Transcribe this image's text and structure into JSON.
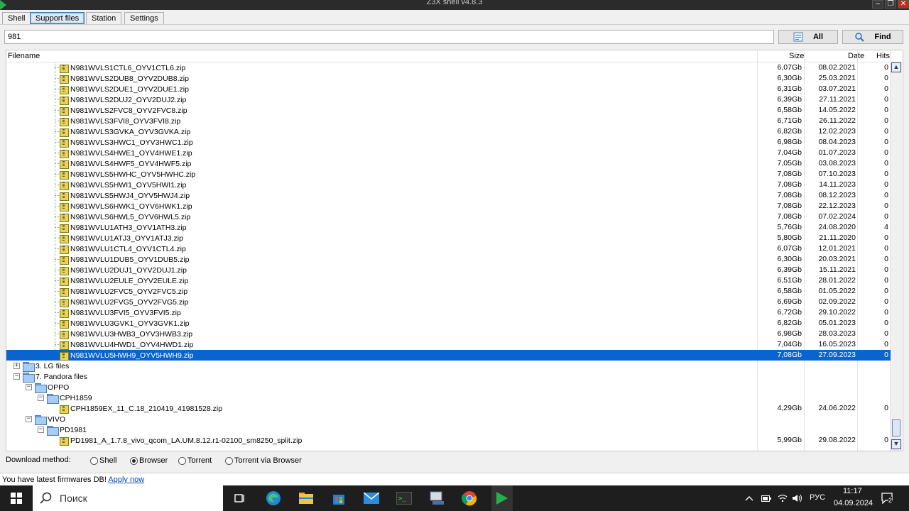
{
  "window": {
    "title": "Z3X shell v4.8.3",
    "controls": [
      "–",
      "❐",
      "✕"
    ]
  },
  "tabs": [
    {
      "label": "Shell",
      "active": false
    },
    {
      "label": "Support files",
      "active": true
    },
    {
      "label": "Station",
      "active": false
    },
    {
      "label": "Settings",
      "active": false
    }
  ],
  "search": {
    "value": "981",
    "all_label": "All",
    "find_label": "Find"
  },
  "columns": {
    "filename": "Filename",
    "size": "Size",
    "date": "Date",
    "hits": "Hits"
  },
  "files": [
    {
      "name": "N981WVLS1CTL6_OYV1CTL6.zip",
      "size": "6,07Gb",
      "date": "08.02.2021",
      "hits": "0"
    },
    {
      "name": "N981WVLS2DUB8_OYV2DUB8.zip",
      "size": "6,30Gb",
      "date": "25.03.2021",
      "hits": "0"
    },
    {
      "name": "N981WVLS2DUE1_OYV2DUE1.zip",
      "size": "6,31Gb",
      "date": "03.07.2021",
      "hits": "0"
    },
    {
      "name": "N981WVLS2DUJ2_OYV2DUJ2.zip",
      "size": "6,39Gb",
      "date": "27.11.2021",
      "hits": "0"
    },
    {
      "name": "N981WVLS2FVC8_OYV2FVC8.zip",
      "size": "6,58Gb",
      "date": "14.05.2022",
      "hits": "0"
    },
    {
      "name": "N981WVLS3FVI8_OYV3FVI8.zip",
      "size": "6,71Gb",
      "date": "26.11.2022",
      "hits": "0"
    },
    {
      "name": "N981WVLS3GVKA_OYV3GVKA.zip",
      "size": "6,82Gb",
      "date": "12.02.2023",
      "hits": "0"
    },
    {
      "name": "N981WVLS3HWC1_OYV3HWC1.zip",
      "size": "6,98Gb",
      "date": "08.04.2023",
      "hits": "0"
    },
    {
      "name": "N981WVLS4HWE1_OYV4HWE1.zip",
      "size": "7,04Gb",
      "date": "01.07.2023",
      "hits": "0"
    },
    {
      "name": "N981WVLS4HWF5_OYV4HWF5.zip",
      "size": "7,05Gb",
      "date": "03.08.2023",
      "hits": "0"
    },
    {
      "name": "N981WVLS5HWHC_OYV5HWHC.zip",
      "size": "7,08Gb",
      "date": "07.10.2023",
      "hits": "0"
    },
    {
      "name": "N981WVLS5HWI1_OYV5HWI1.zip",
      "size": "7,08Gb",
      "date": "14.11.2023",
      "hits": "0"
    },
    {
      "name": "N981WVLS5HWJ4_OYV5HWJ4.zip",
      "size": "7,08Gb",
      "date": "08.12.2023",
      "hits": "0"
    },
    {
      "name": "N981WVLS6HWK1_OYV6HWK1.zip",
      "size": "7,08Gb",
      "date": "22.12.2023",
      "hits": "0"
    },
    {
      "name": "N981WVLS6HWL5_OYV6HWL5.zip",
      "size": "7,08Gb",
      "date": "07.02.2024",
      "hits": "0"
    },
    {
      "name": "N981WVLU1ATH3_OYV1ATH3.zip",
      "size": "5,76Gb",
      "date": "24.08.2020",
      "hits": "4"
    },
    {
      "name": "N981WVLU1ATJ3_OYV1ATJ3.zip",
      "size": "5,80Gb",
      "date": "21.11.2020",
      "hits": "0"
    },
    {
      "name": "N981WVLU1CTL4_OYV1CTL4.zip",
      "size": "6,07Gb",
      "date": "12.01.2021",
      "hits": "0"
    },
    {
      "name": "N981WVLU1DUB5_OYV1DUB5.zip",
      "size": "6,30Gb",
      "date": "20.03.2021",
      "hits": "0"
    },
    {
      "name": "N981WVLU2DUJ1_OYV2DUJ1.zip",
      "size": "6,39Gb",
      "date": "15.11.2021",
      "hits": "0"
    },
    {
      "name": "N981WVLU2EULE_OYV2EULE.zip",
      "size": "6,51Gb",
      "date": "28.01.2022",
      "hits": "0"
    },
    {
      "name": "N981WVLU2FVC5_OYV2FVC5.zip",
      "size": "6,58Gb",
      "date": "01.05.2022",
      "hits": "0"
    },
    {
      "name": "N981WVLU2FVG5_OYV2FVG5.zip",
      "size": "6,69Gb",
      "date": "02.09.2022",
      "hits": "0"
    },
    {
      "name": "N981WVLU3FVI5_OYV3FVI5.zip",
      "size": "6,72Gb",
      "date": "29.10.2022",
      "hits": "0"
    },
    {
      "name": "N981WVLU3GVK1_OYV3GVK1.zip",
      "size": "6,82Gb",
      "date": "05.01.2023",
      "hits": "0"
    },
    {
      "name": "N981WVLU3HWB3_OYV3HWB3.zip",
      "size": "6,98Gb",
      "date": "28.03.2023",
      "hits": "0"
    },
    {
      "name": "N981WVLU4HWD1_OYV4HWD1.zip",
      "size": "7,04Gb",
      "date": "16.05.2023",
      "hits": "0"
    },
    {
      "name": "N981WVLU5HWH9_OYV5HWH9.zip",
      "size": "7,08Gb",
      "date": "27.09.2023",
      "hits": "0",
      "selected": true
    }
  ],
  "tree": [
    {
      "type": "folder",
      "label": "3. LG files",
      "expander": "+"
    },
    {
      "type": "folder",
      "label": "7. Pandora files",
      "expander": "−"
    },
    {
      "type": "folder",
      "label": "OPPO",
      "expander": "−"
    },
    {
      "type": "folder",
      "label": "CPH1859",
      "expander": "−"
    },
    {
      "type": "file",
      "label": "CPH1859EX_11_C.18_210419_41981528.zip",
      "size": "4,29Gb",
      "date": "24.06.2022",
      "hits": "0"
    },
    {
      "type": "folder",
      "label": "VIVO",
      "expander": "−"
    },
    {
      "type": "folder",
      "label": "PD1981",
      "expander": "−"
    },
    {
      "type": "file",
      "label": "PD1981_A_1.7.8_vivo_qcom_LA.UM.8.12.r1-02100_sm8250_split.zip",
      "size": "5,99Gb",
      "date": "29.08.2022",
      "hits": "0"
    }
  ],
  "download": {
    "label": "Download method:",
    "options": [
      {
        "label": "Shell",
        "selected": false
      },
      {
        "label": "Browser",
        "selected": true
      },
      {
        "label": "Torrent",
        "selected": false
      },
      {
        "label": "Torrent via Browser",
        "selected": false
      }
    ]
  },
  "status": {
    "text": "You have latest firmwares DB! ",
    "link": "Apply now"
  },
  "taskbar": {
    "search_placeholder": "Поиск",
    "language": "РУС",
    "time": "11:17",
    "date": "04.09.2024",
    "notifications": "2"
  },
  "colors": {
    "selection": "#0a64d0",
    "titlebar": "#2b2b2b",
    "taskbar": "#1e1e1e"
  }
}
